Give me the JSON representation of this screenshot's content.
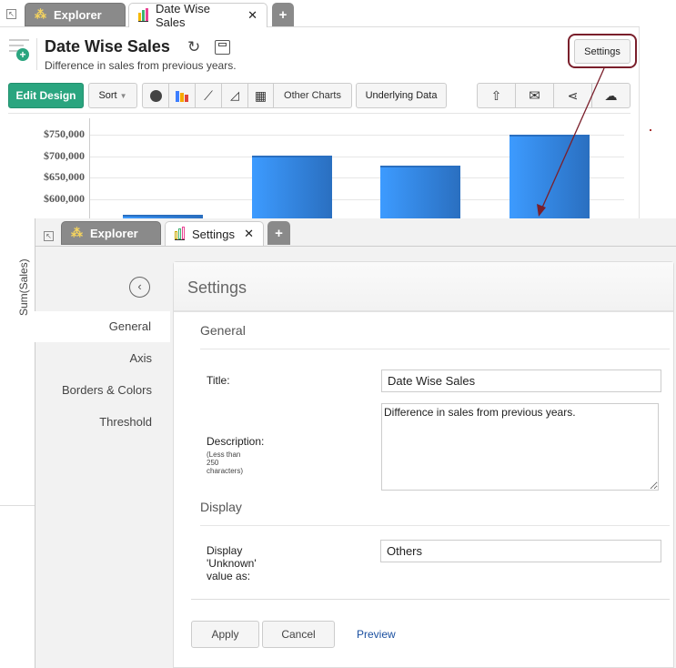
{
  "back_window": {
    "tabs": [
      {
        "label": "Explorer"
      },
      {
        "label": "Date Wise Sales"
      }
    ],
    "title": "Date Wise Sales",
    "description": "Difference in sales from previous years.",
    "toolbar": {
      "edit_design": "Edit Design",
      "sort": "Sort",
      "other_charts": "Other Charts",
      "underlying_data": "Underlying Data",
      "settings": "Settings"
    },
    "y_axis_label": "Sum(Sales)"
  },
  "chart_data": {
    "type": "bar",
    "title": "Date Wise Sales",
    "ylabel": "Sum(Sales)",
    "yticks": [
      "$750,000",
      "$700,000",
      "$650,000",
      "$600,000"
    ],
    "ytick_values": [
      750000,
      700000,
      650000,
      600000
    ],
    "values": [
      562000,
      702000,
      677000,
      749000
    ],
    "ylim": [
      550000,
      760000
    ],
    "color": "#3d9bff"
  },
  "settings_window": {
    "tabs": [
      {
        "label": "Explorer"
      },
      {
        "label": "Settings"
      }
    ],
    "sidebar": [
      {
        "label": "General"
      },
      {
        "label": "Axis"
      },
      {
        "label": "Borders & Colors"
      },
      {
        "label": "Threshold"
      }
    ],
    "header": "Settings",
    "general": {
      "heading": "General",
      "title_label": "Title:",
      "title_value": "Date Wise Sales",
      "description_label": "Description:",
      "description_hint": "(Less than 250 characters)",
      "description_value": "Difference in sales from previous years."
    },
    "display": {
      "heading": "Display",
      "unknown_label": "Display 'Unknown' value as:",
      "unknown_value": "Others"
    },
    "buttons": {
      "apply": "Apply",
      "cancel": "Cancel",
      "preview": "Preview"
    }
  },
  "colors": {
    "accent": "#2aa57f",
    "annotation": "#7a1f2b",
    "link": "#1a4fa0"
  }
}
